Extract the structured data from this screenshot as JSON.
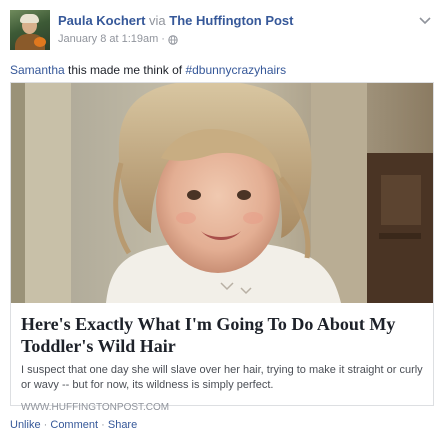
{
  "post": {
    "author": "Paula Kochert",
    "via_word": "via",
    "page": "The Huffington Post",
    "timestamp": "January 8 at 1:19am",
    "separator": "·",
    "privacy_icon": "globe-icon",
    "menu_icon": "chevron-down-icon"
  },
  "caption": {
    "mention": "Samantha",
    "text": " this made me think of ",
    "hashtag": "#dbunnycrazyhairs"
  },
  "share": {
    "title": "Here's Exactly What I'm Going To Do About My Toddler's Wild Hair",
    "description": "I suspect that one day she will slave over her hair, trying to make it straight or curly or wavy -- but for now, its wildness is simply perfect.",
    "domain": "WWW.HUFFINGTONPOST.COM"
  },
  "actions": {
    "unlike": "Unlike",
    "comment": "Comment",
    "share": "Share",
    "dot": "·"
  },
  "colors": {
    "link": "#365899",
    "meta": "#90949c",
    "text": "#1d2129",
    "border": "#dddfe2"
  }
}
